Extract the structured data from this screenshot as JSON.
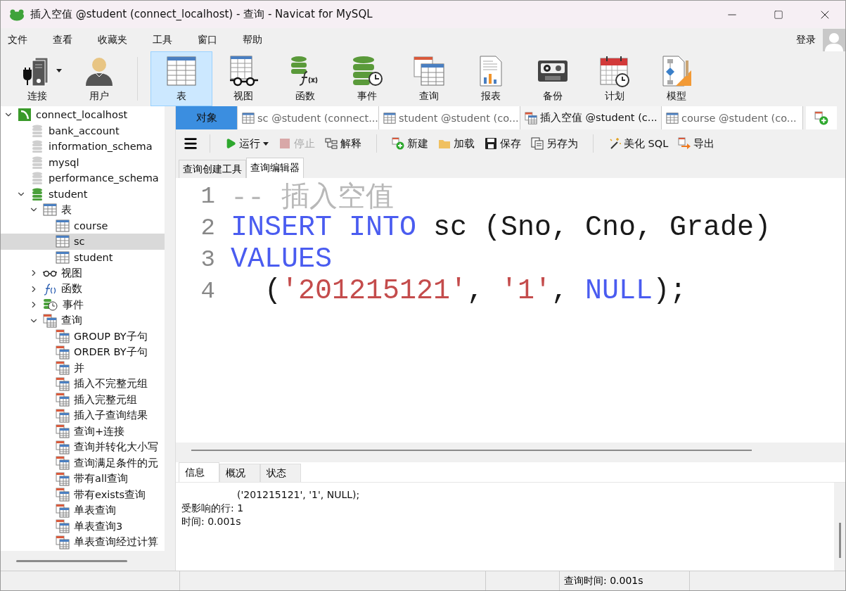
{
  "window": {
    "title": "插入空值 @student (connect_localhost) - 查询 - Navicat for MySQL"
  },
  "menu": [
    "文件",
    "查看",
    "收藏夹",
    "工具",
    "窗口",
    "帮助"
  ],
  "login": "登录",
  "toolbar": [
    {
      "label": "连接",
      "kind": "connect",
      "dropdown": true,
      "selected": false
    },
    {
      "label": "用户",
      "kind": "user",
      "selected": false
    },
    {
      "label": "表",
      "kind": "table",
      "selected": true
    },
    {
      "label": "视图",
      "kind": "view",
      "selected": false
    },
    {
      "label": "函数",
      "kind": "function",
      "selected": false
    },
    {
      "label": "事件",
      "kind": "event",
      "selected": false
    },
    {
      "label": "查询",
      "kind": "query",
      "selected": false
    },
    {
      "label": "报表",
      "kind": "report",
      "selected": false
    },
    {
      "label": "备份",
      "kind": "backup",
      "selected": false
    },
    {
      "label": "计划",
      "kind": "schedule",
      "selected": false
    },
    {
      "label": "模型",
      "kind": "model",
      "selected": false
    }
  ],
  "tree": [
    {
      "label": "connect_localhost",
      "kind": "connection",
      "expanded": true,
      "selected": false,
      "children": [
        {
          "label": "bank_account",
          "kind": "closed",
          "selected": false
        },
        {
          "label": "information_schema",
          "kind": "closed",
          "selected": false
        },
        {
          "label": "mysql",
          "kind": "closed",
          "selected": false
        },
        {
          "label": "performance_schema",
          "kind": "closed",
          "selected": false
        },
        {
          "label": "student",
          "kind": "open",
          "expanded": true,
          "selected": false,
          "children": [
            {
              "label": "表",
              "kind": "table",
              "expanded": true,
              "selected": false,
              "children": [
                {
                  "label": "course",
                  "kind": "table",
                  "selected": false
                },
                {
                  "label": "sc",
                  "kind": "table",
                  "selected": true
                },
                {
                  "label": "student",
                  "kind": "table",
                  "selected": false
                }
              ]
            },
            {
              "label": "视图",
              "kind": "view",
              "expanded": false,
              "selected": false
            },
            {
              "label": "函数",
              "kind": "function",
              "expanded": false,
              "selected": false
            },
            {
              "label": "事件",
              "kind": "event",
              "expanded": false,
              "selected": false
            },
            {
              "label": "查询",
              "kind": "query",
              "expanded": true,
              "selected": false,
              "children": [
                {
                  "label": "GROUP BY子句",
                  "kind": "query",
                  "selected": false
                },
                {
                  "label": "ORDER BY子句",
                  "kind": "query",
                  "selected": false
                },
                {
                  "label": "并",
                  "kind": "query",
                  "selected": false
                },
                {
                  "label": "插入不完整元组",
                  "kind": "query",
                  "selected": false
                },
                {
                  "label": "插入完整元组",
                  "kind": "query",
                  "selected": false
                },
                {
                  "label": "插入子查询结果",
                  "kind": "query",
                  "selected": false
                },
                {
                  "label": "查询+连接",
                  "kind": "query",
                  "selected": false
                },
                {
                  "label": "查询并转化大小写",
                  "kind": "query",
                  "selected": false
                },
                {
                  "label": "查询满足条件的元",
                  "kind": "query",
                  "selected": false
                },
                {
                  "label": "带有all查询",
                  "kind": "query",
                  "selected": false
                },
                {
                  "label": "带有exists查询",
                  "kind": "query",
                  "selected": false
                },
                {
                  "label": "单表查询",
                  "kind": "query",
                  "selected": false
                },
                {
                  "label": "单表查询3",
                  "kind": "query",
                  "selected": false
                },
                {
                  "label": "单表查询经过计算",
                  "kind": "query",
                  "selected": false
                }
              ]
            }
          ]
        }
      ]
    }
  ],
  "tabs": [
    {
      "label": "对象",
      "kind": "object",
      "selected": false
    },
    {
      "label": "sc @student (connect...",
      "kind": "table",
      "selected": false
    },
    {
      "label": "student @student (co...",
      "kind": "table",
      "selected": false
    },
    {
      "label": "插入空值 @student (c...",
      "kind": "query",
      "selected": true
    },
    {
      "label": "course @student (co...",
      "kind": "table",
      "selected": false
    }
  ],
  "editor_toolbar": [
    {
      "label": "运行",
      "kind": "run",
      "dropdown": true,
      "disabled": false
    },
    {
      "label": "停止",
      "kind": "stop",
      "disabled": true
    },
    {
      "label": "解释",
      "kind": "explain",
      "disabled": false
    },
    {
      "label": "新建",
      "kind": "new",
      "disabled": false
    },
    {
      "label": "加载",
      "kind": "load",
      "disabled": false
    },
    {
      "label": "保存",
      "kind": "save",
      "disabled": false
    },
    {
      "label": "另存为",
      "kind": "saveas",
      "disabled": false
    },
    {
      "label": "美化 SQL",
      "kind": "beautify",
      "disabled": false
    },
    {
      "label": "导出",
      "kind": "export",
      "disabled": false
    }
  ],
  "sub_tabs": [
    {
      "label": "查询创建工具",
      "selected": false
    },
    {
      "label": "查询编辑器",
      "selected": true
    }
  ],
  "code": [
    {
      "number": "1",
      "tokens": [
        {
          "kind": "comment",
          "text": "-- 插入空值"
        }
      ]
    },
    {
      "number": "2",
      "tokens": [
        {
          "kind": "keyword",
          "text": "INSERT INTO"
        },
        {
          "kind": "plain",
          "text": " sc (Sno, Cno, Grade)"
        }
      ]
    },
    {
      "number": "3",
      "tokens": [
        {
          "kind": "keyword",
          "text": "VALUES"
        }
      ]
    },
    {
      "number": "4",
      "tokens": [
        {
          "kind": "plain",
          "text": "  ("
        },
        {
          "kind": "string",
          "text": "'201215121'"
        },
        {
          "kind": "plain",
          "text": ", "
        },
        {
          "kind": "string",
          "text": "'1'"
        },
        {
          "kind": "plain",
          "text": ", "
        },
        {
          "kind": "keyword",
          "text": "NULL"
        },
        {
          "kind": "plain",
          "text": ");"
        }
      ]
    }
  ],
  "result_tabs": [
    {
      "label": "信息",
      "selected": true
    },
    {
      "label": "概况",
      "selected": false
    },
    {
      "label": "状态",
      "selected": false
    }
  ],
  "messages": [
    {
      "text": "('201215121', '1', NULL);",
      "continued": true
    },
    {
      "text": "受影响的行: 1",
      "continued": false
    },
    {
      "text": "时间: 0.001s",
      "continued": false
    }
  ],
  "status_bar": {
    "query_time": "查询时间: 0.001s"
  }
}
